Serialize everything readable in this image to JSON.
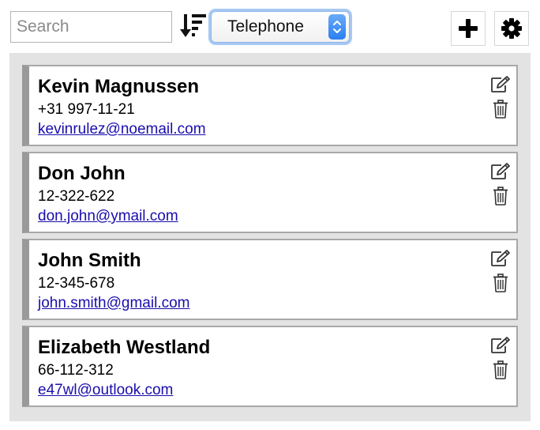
{
  "toolbar": {
    "search": {
      "placeholder": "Search",
      "value": ""
    },
    "sort_icon": "sort-descending-icon",
    "sort_field": {
      "selected": "Telephone"
    },
    "add_icon": "plus-icon",
    "settings_icon": "gear-icon"
  },
  "contacts": [
    {
      "name": "Kevin Magnussen",
      "phone": "+31 997-11-21",
      "email": "kevinrulez@noemail.com"
    },
    {
      "name": "Don John",
      "phone": "12-322-622",
      "email": "don.john@ymail.com"
    },
    {
      "name": "John Smith",
      "phone": "12-345-678",
      "email": "john.smith@gmail.com"
    },
    {
      "name": "Elizabeth Westland",
      "phone": "66-112-312",
      "email": "e47wl@outlook.com"
    }
  ],
  "card_icons": {
    "edit": "edit-icon",
    "delete": "trash-icon"
  },
  "colors": {
    "link": "#1a0dab",
    "select_focus": "#a7c8f3",
    "select_arrow": "#2a7ff0",
    "panel_bg": "#e3e3e3",
    "card_accent": "#9a9a9a"
  }
}
